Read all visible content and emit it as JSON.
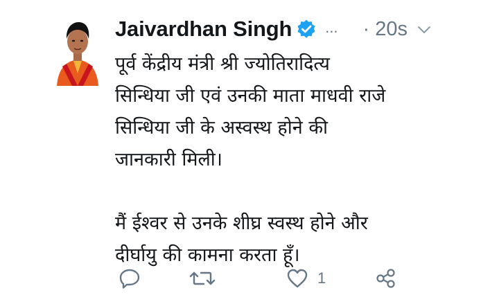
{
  "tweet": {
    "display_name": "Jaivardhan Singh",
    "more": "...",
    "timestamp": "· 20s",
    "lines": [
      "पूर्व केंद्रीय मंत्री श्री ज्योतिरादित्य",
      "सिन्धिया जी एवं उनकी माता माधवी राजे",
      "सिन्धिया जी के अस्वस्थ होने की",
      "जानकारी मिली।",
      "मैं ईश्वर से उनके शीघ्र स्वस्थ होने और",
      "दीर्घायु की कामना करता हूँ।"
    ],
    "like_count": "1"
  },
  "icons": {
    "verified": "verified-badge-icon",
    "chevron": "chevron-down-icon",
    "reply": "reply-icon",
    "retweet": "retweet-icon",
    "like": "heart-icon",
    "share": "share-icon"
  },
  "colors": {
    "verified": "#1da1f2",
    "muted": "#657786",
    "text": "#14171a"
  }
}
